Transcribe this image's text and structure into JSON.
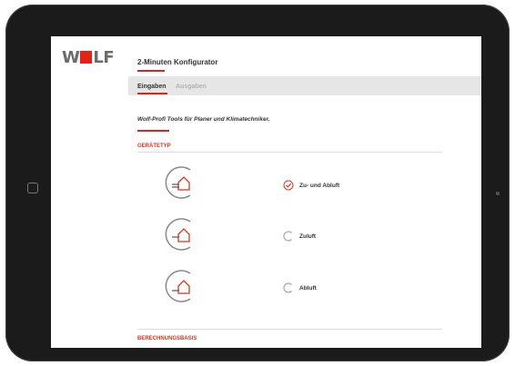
{
  "header": {
    "logo_text": "WOLF",
    "app_title": "2-Minuten Konfigurator"
  },
  "tabs": [
    {
      "label": "Eingaben",
      "active": true
    },
    {
      "label": "Ausgaben",
      "active": false
    }
  ],
  "tagline": "Wolf-Profi Tools für Planer und Klimatechniker.",
  "sections": {
    "device_type": {
      "heading": "GERÄTETYP",
      "options": [
        {
          "label": "Zu- und Abluft",
          "selected": true,
          "icon": "house-supply-exhaust-icon"
        },
        {
          "label": "Zuluft",
          "selected": false,
          "icon": "house-supply-icon"
        },
        {
          "label": "Abluft",
          "selected": false,
          "icon": "house-exhaust-icon"
        }
      ]
    },
    "calculation_basis": {
      "heading": "BERECHNUNGSBASIS"
    }
  },
  "colors": {
    "accent": "#e2231a",
    "section_heading": "#d9351e",
    "tab_bar": "#e6e6e6",
    "device_frame": "#1b1b1b"
  }
}
